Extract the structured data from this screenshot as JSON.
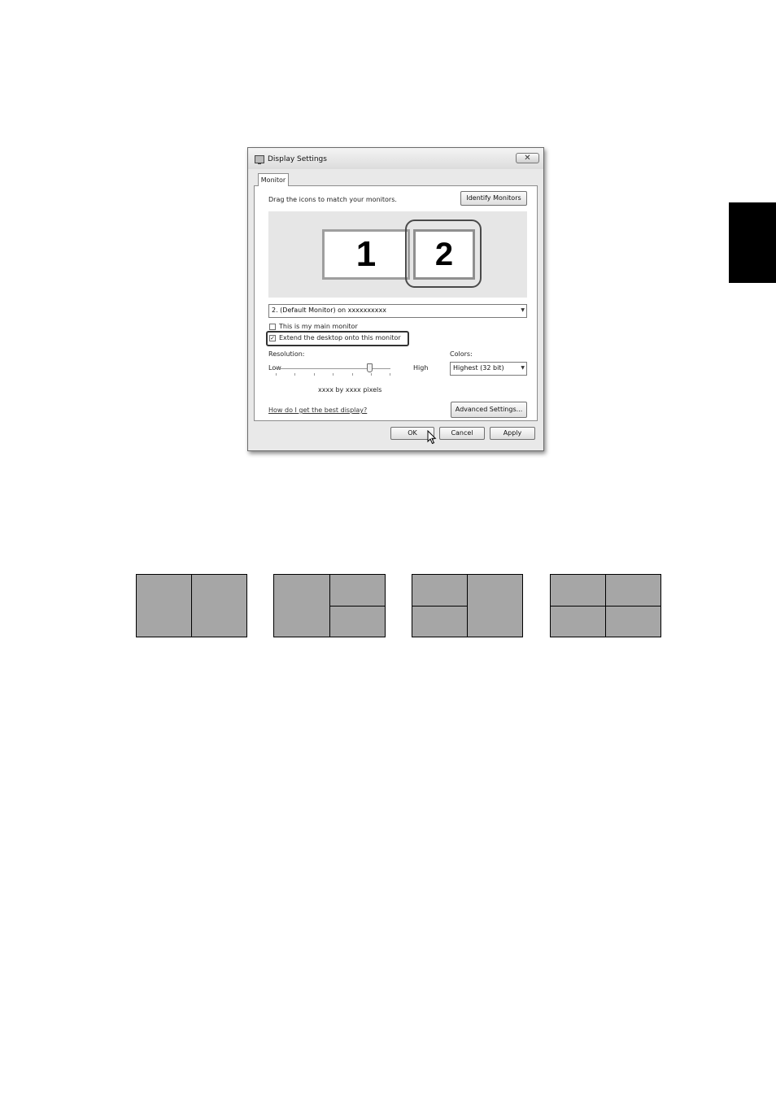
{
  "dialog": {
    "title": "Display Settings",
    "close_glyph": "✕",
    "tab_label": "Monitor",
    "drag_instruction": "Drag the icons to match your monitors.",
    "identify_button": "Identify Monitors",
    "monitors": [
      {
        "number": "1"
      },
      {
        "number": "2"
      }
    ],
    "monitor_select_value": "2. (Default Monitor) on xxxxxxxxxx",
    "main_monitor_label": "This is my main monitor",
    "main_monitor_checked": false,
    "extend_label": "Extend the desktop onto this monitor",
    "extend_checked": true,
    "resolution_label": "Resolution:",
    "low_label": "Low",
    "high_label": "High",
    "resolution_value_text": "xxxx by xxxx pixels",
    "colors_label": "Colors:",
    "colors_value": "Highest (32 bit)",
    "help_link": "How do I get the best display?",
    "advanced_button": "Advanced Settings...",
    "ok_button": "OK",
    "cancel_button": "Cancel",
    "apply_button": "Apply"
  },
  "icons": {
    "check": "✓",
    "dropdown_arrow": "▼"
  },
  "colors": {
    "side_tab": "#000000",
    "layout_pane": "#a6a6a6",
    "monitor_area": "#e6e6e6"
  }
}
